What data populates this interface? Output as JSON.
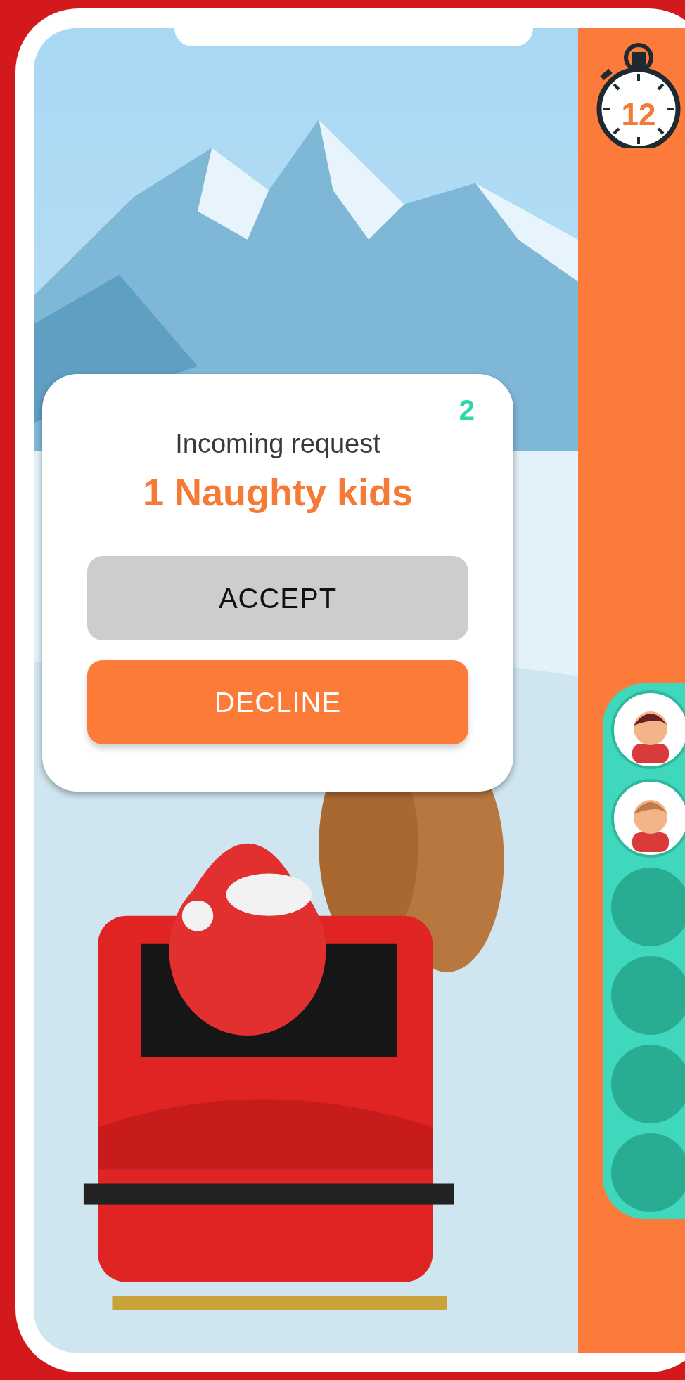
{
  "timer": {
    "value": "12"
  },
  "request_dialog": {
    "count": "2",
    "title": "Incoming request",
    "request": "1 Naughty kids",
    "buttons": [
      {
        "label": "ACCEPT",
        "kind": "accept"
      },
      {
        "label": "DECLINE",
        "kind": "decline"
      }
    ]
  },
  "kid_slots": [
    {
      "filled": true,
      "kind": "girl"
    },
    {
      "filled": true,
      "kind": "boy"
    },
    {
      "filled": false
    },
    {
      "filled": false
    },
    {
      "filled": false
    },
    {
      "filled": false
    }
  ]
}
